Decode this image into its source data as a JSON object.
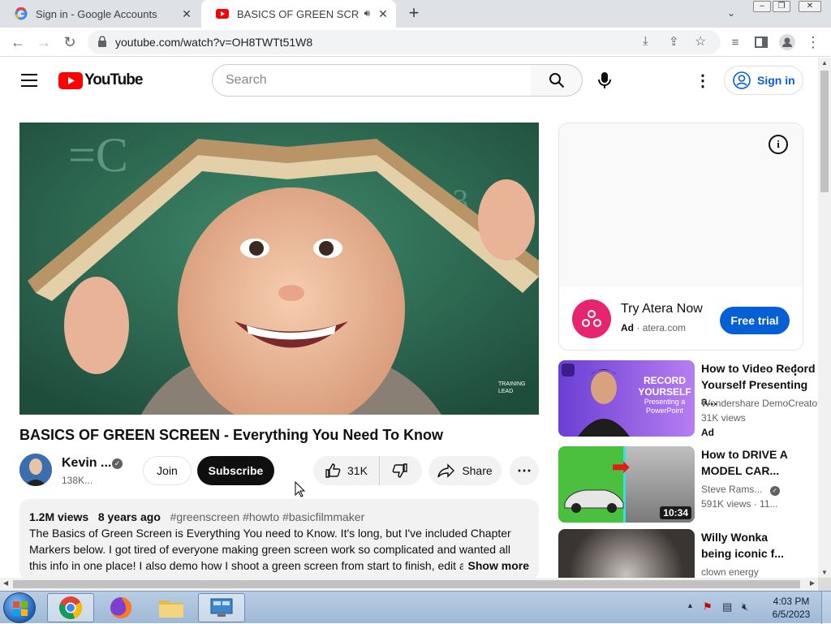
{
  "browser": {
    "tabs": [
      {
        "title": "Sign in - Google Accounts",
        "active": false
      },
      {
        "title": "BASICS OF GREEN SCREEN -",
        "active": true
      }
    ],
    "url": "youtube.com/watch?v=OH8TWTt51W8"
  },
  "youtube": {
    "logo_text": "YouTube",
    "search_placeholder": "Search",
    "signin_label": "Sign in"
  },
  "video": {
    "title": "BASICS OF GREEN SCREEN - Everything You Need To Know",
    "channel_name": "Kevin ...",
    "subscribers": "138K...",
    "join_label": "Join",
    "subscribe_label": "Subscribe",
    "likes": "31K",
    "share_label": "Share",
    "views": "1.2M views",
    "age": "8 years ago",
    "hashtags": "#greenscreen #howto #basicfilmmaker",
    "description": "The Basics of Green Screen is Everything You need to Know. It's long, but I've included Chapter Markers below. I got tired of everyone making green screen work so complicated and wanted all this info in one place!  I also demo how I shoot a green screen from start to finish, edit a",
    "show_more": "Show more",
    "watermark": "TRAINING LEAD"
  },
  "ad": {
    "title": "Try Atera Now",
    "label": "Ad",
    "domain": "atera.com",
    "cta": "Free trial"
  },
  "recommendations": [
    {
      "title": "How to Video Record Yourself Presenting a...",
      "channel": "Wondershare DemoCreator",
      "meta": "31K views",
      "badge": "Ad",
      "thumb_text_1": "RECORD",
      "thumb_text_2": "YOURSELF",
      "thumb_text_3": "Presenting a",
      "thumb_text_4": "PowerPoint"
    },
    {
      "title": "How to DRIVE A MODEL CAR...",
      "channel": "Steve Rams...",
      "meta": "591K views · 11...",
      "duration": "10:34"
    },
    {
      "title": "Willy Wonka being iconic f...",
      "channel": "clown energy"
    }
  ],
  "taskbar": {
    "time": "4:03 PM",
    "date": "6/5/2023"
  },
  "colors": {
    "yt_red": "#ff0000",
    "subscribe_bg": "#0f0f0f",
    "link_blue": "#065fd4",
    "ad_cta": "#065fd4",
    "atera_pink": "#e6246f"
  }
}
